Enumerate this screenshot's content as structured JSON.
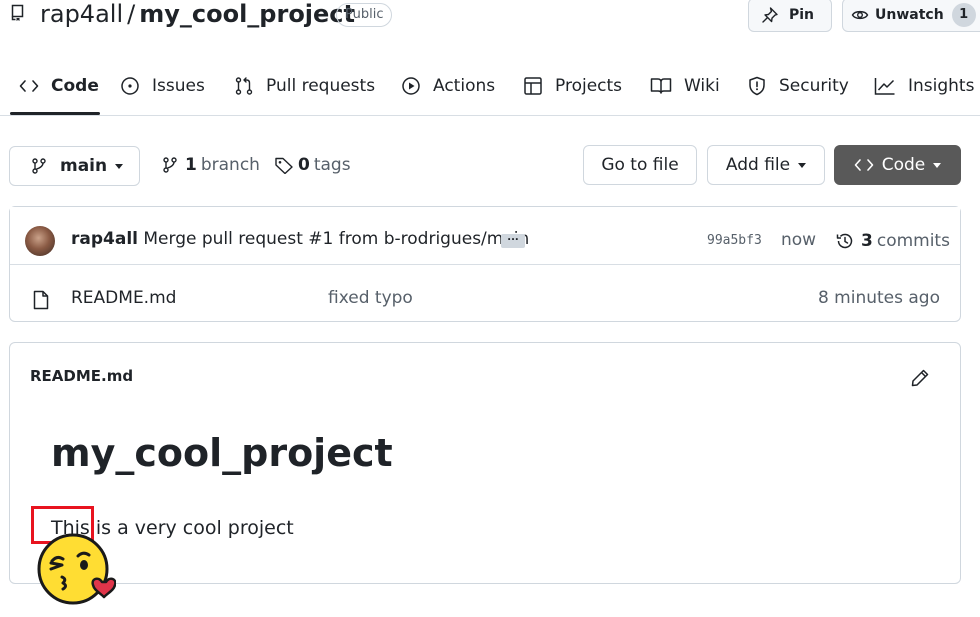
{
  "repo": {
    "owner": "rap4all",
    "separator": "/",
    "name": "my_cool_project",
    "visibility": "Public",
    "pin_label": "Pin",
    "unwatch_label": "Unwatch",
    "watch_count": "1"
  },
  "tabs": [
    {
      "label": "Code",
      "icon": "code-icon",
      "selected": true
    },
    {
      "label": "Issues",
      "icon": "issue-opened-icon"
    },
    {
      "label": "Pull requests",
      "icon": "git-pull-request-icon"
    },
    {
      "label": "Actions",
      "icon": "play-icon"
    },
    {
      "label": "Projects",
      "icon": "table-icon"
    },
    {
      "label": "Wiki",
      "icon": "book-icon"
    },
    {
      "label": "Security",
      "icon": "shield-icon"
    },
    {
      "label": "Insights",
      "icon": "graph-icon"
    }
  ],
  "toolbar": {
    "branch_selected": "main",
    "branch_count": "1",
    "branch_word": "branch",
    "tag_count": "0",
    "tag_word": "tags",
    "goto_label": "Go to file",
    "add_file_label": "Add file",
    "code_label": "Code"
  },
  "latest_commit": {
    "author": "rap4all",
    "message": "Merge pull request #1 from b-rodrigues/main",
    "ellipsis": "...",
    "sha": "99a5bf3",
    "time": "now",
    "commit_count": "3",
    "commit_word": "commits"
  },
  "files": [
    {
      "name": "README.md",
      "last_commit": "fixed typo",
      "age": "8 minutes ago"
    }
  ],
  "readme": {
    "filename": "README.md",
    "heading": "my_cool_project",
    "paragraph": "This is a very cool project"
  },
  "colors": {
    "code_button_bg": "#595959",
    "highlight": "#e8131f",
    "emoji_yellow": "#ffdd33",
    "heart": "#e0354a"
  },
  "overlay": {
    "emoji": "kissing-face-with-heart"
  }
}
